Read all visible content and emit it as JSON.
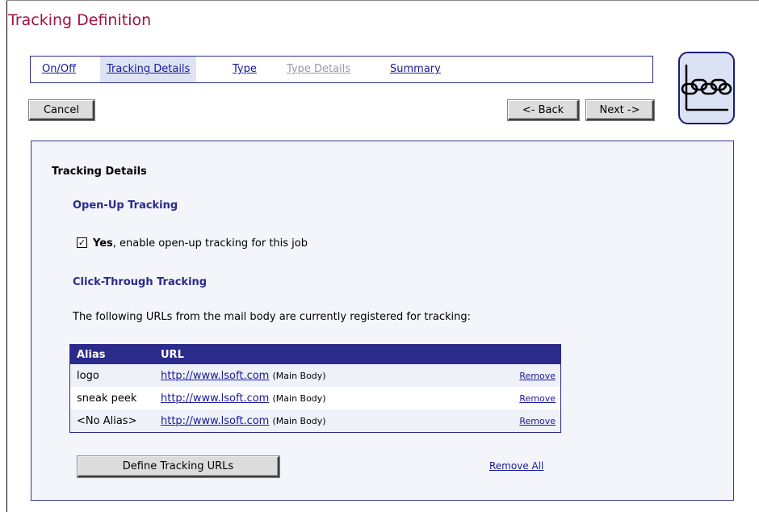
{
  "page": {
    "title": "Tracking Definition"
  },
  "wizard": {
    "tabs": [
      {
        "label": "On/Off",
        "state": "link"
      },
      {
        "label": "Tracking Details",
        "state": "active"
      },
      {
        "label": "Type",
        "state": "link"
      },
      {
        "label": "Type Details",
        "state": "disabled"
      },
      {
        "label": "Summary",
        "state": "link"
      }
    ],
    "cancel_label": "Cancel",
    "back_label": "<- Back",
    "next_label": "Next ->"
  },
  "logo": {
    "icon": "chain-links-icon"
  },
  "details": {
    "heading": "Tracking Details",
    "open_up": {
      "title": "Open-Up Tracking",
      "checkbox_checked": true,
      "checkbox_mark": "✓",
      "yes_label": "Yes",
      "option_text": ", enable open-up tracking for this job"
    },
    "click_through": {
      "title": "Click-Through Tracking",
      "intro": "The following URLs from the mail body are currently registered for tracking:",
      "columns": [
        "Alias",
        "URL"
      ],
      "rows": [
        {
          "alias": "logo",
          "url": "http://www.lsoft.com",
          "location": "(Main Body)",
          "remove": "Remove"
        },
        {
          "alias": "sneak peek",
          "url": "http://www.lsoft.com",
          "location": "(Main Body)",
          "remove": "Remove"
        },
        {
          "alias": "<No Alias>",
          "url": "http://www.lsoft.com",
          "location": "(Main Body)",
          "remove": "Remove"
        }
      ],
      "define_button": "Define Tracking URLs",
      "remove_all": "Remove All"
    }
  },
  "colors": {
    "title": "#a0123f",
    "accent": "#2b2b8c",
    "panel_bg": "#f3f5fb"
  }
}
